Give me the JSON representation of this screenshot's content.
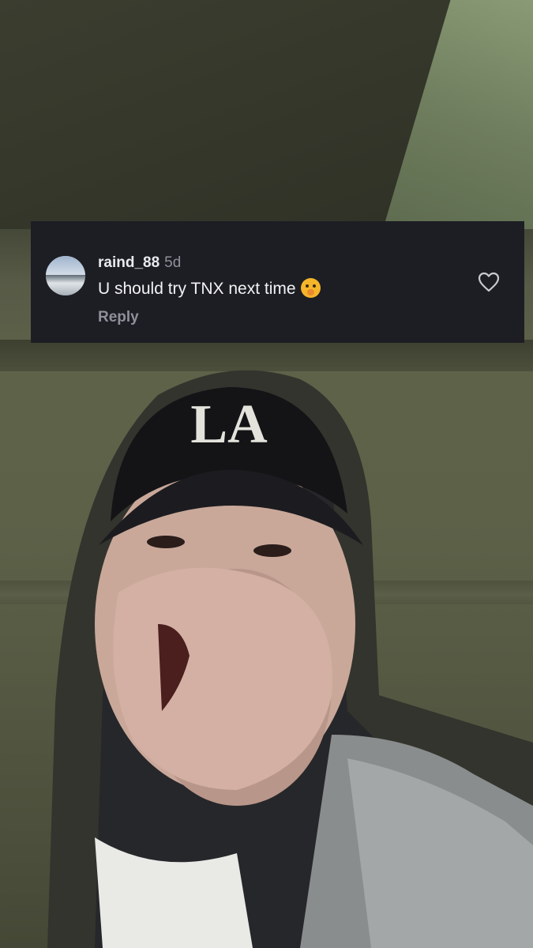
{
  "comment": {
    "username": "raind_88",
    "time": "5d",
    "text": "U should try TNX next time",
    "emoji": "face-with-hand-over-mouth-emoji",
    "reply_label": "Reply",
    "like_icon": "heart-outline-icon"
  },
  "video": {
    "cap_logo_text": "LA"
  },
  "colors": {
    "card_bg": "#1d1e24",
    "username": "#e9eaee",
    "muted": "#8e909a",
    "text": "#f2f2f5"
  }
}
